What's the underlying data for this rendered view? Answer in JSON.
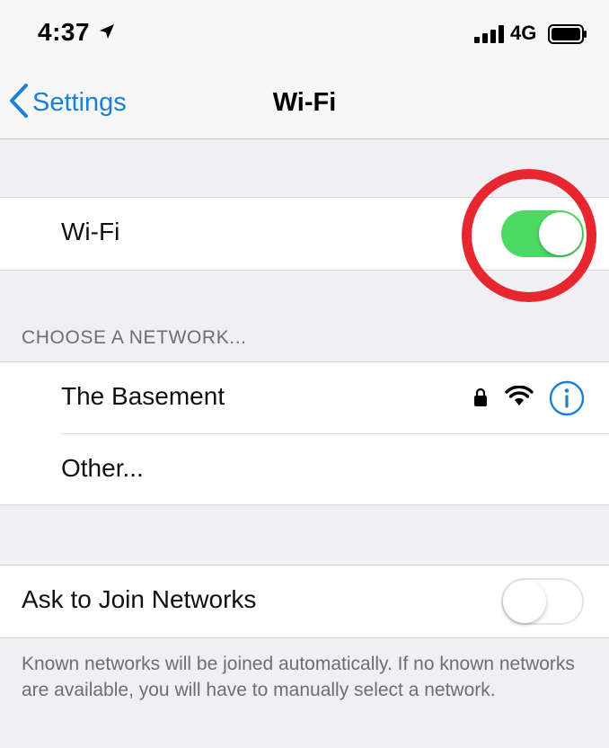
{
  "status_bar": {
    "time": "4:37",
    "network_type": "4G",
    "location_icon": "location-arrow-icon",
    "signal_icon": "cellular-signal-icon",
    "battery_icon": "battery-icon"
  },
  "nav": {
    "back_label": "Settings",
    "title": "Wi-Fi",
    "back_icon": "chevron-left-icon"
  },
  "wifi_toggle": {
    "label": "Wi-Fi",
    "state": "on"
  },
  "networks": {
    "header": "CHOOSE A NETWORK...",
    "items": [
      {
        "name": "The Basement",
        "secured": true,
        "icons": [
          "lock-icon",
          "wifi-signal-icon",
          "info-icon"
        ]
      },
      {
        "name": "Other..."
      }
    ]
  },
  "ask_to_join": {
    "label": "Ask to Join Networks",
    "state": "off",
    "footer": "Known networks will be joined automatically. If no known networks are available, you will have to manually select a network."
  },
  "colors": {
    "accent_blue": "#1a7fd6",
    "toggle_green": "#4cd964",
    "annotation_red": "#e8262f",
    "background": "#efeff4"
  }
}
